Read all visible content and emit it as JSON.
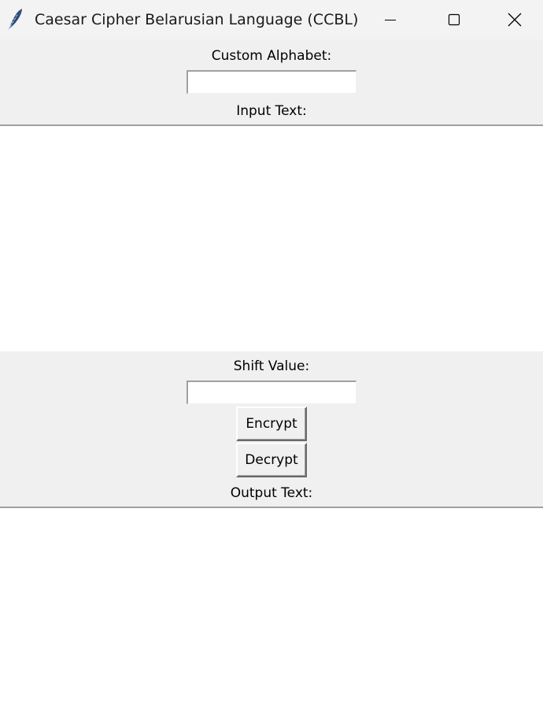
{
  "window": {
    "title": "Caesar Cipher Belarusian Language (CCBL)",
    "icon": "feather-icon",
    "controls": [
      "minimize-icon",
      "maximize-icon",
      "close-icon"
    ]
  },
  "custom_alphabet": {
    "label": "Custom Alphabet:",
    "value": ""
  },
  "input_text": {
    "label": "Input Text:",
    "value": ""
  },
  "shift": {
    "label": "Shift Value:",
    "value": ""
  },
  "buttons": {
    "encrypt": "Encrypt",
    "decrypt": "Decrypt"
  },
  "output_text": {
    "label": "Output Text:",
    "value": ""
  },
  "colors": {
    "window_background": "#f0f0f0",
    "field_background": "#ffffff",
    "feather": "#2f4f7f"
  }
}
